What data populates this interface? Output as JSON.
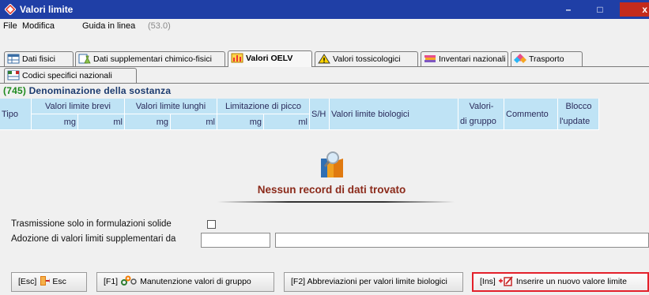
{
  "window": {
    "title": "Valori limite",
    "min_symbol": "–",
    "max_symbol": "□",
    "close_symbol": "x"
  },
  "menu": {
    "file": "File",
    "modifica": "Modifica",
    "guida": "Guida in linea",
    "version": "(53.0)"
  },
  "tabs": [
    {
      "label": "Dati fisici",
      "icon": "table-icon"
    },
    {
      "label": "Dati supplementari chimico-fisici",
      "icon": "chemistry-icon"
    },
    {
      "label": "Valori OELV",
      "icon": "chart-icon",
      "active": true
    },
    {
      "label": "Valori tossicologici",
      "icon": "warning-icon"
    },
    {
      "label": "Inventari nazionali",
      "icon": "books-icon"
    },
    {
      "label": "Trasporto",
      "icon": "transport-icon"
    },
    {
      "label": "Codici specifici nazionali",
      "icon": "flag-table-icon"
    }
  ],
  "section": {
    "number": "(745)",
    "title": "Denominazione della sostanza"
  },
  "grid": {
    "tipo": "Tipo",
    "brevi": "Valori limite brevi",
    "lunghi": "Valori limite lunghi",
    "picco": "Limitazione di picco",
    "mg": "mg",
    "ml": "ml",
    "sh": "S/H",
    "biologici": "Valori limite biologici",
    "gruppo_top": "Valori-",
    "gruppo_bottom": "di gruppo",
    "commento": "Commento",
    "blocco_top": "Blocco",
    "blocco_bottom": "l'update"
  },
  "empty_state": {
    "message": "Nessun record di dati trovato",
    "icon": "search-document-icon"
  },
  "form": {
    "trasmissione_label": "Trasmissione solo in formulazioni solide",
    "trasmissione_checked": false,
    "adozione_label": "Adozione di valori limiti supplementari da",
    "adozione_value_1": "",
    "adozione_value_2": ""
  },
  "buttons": {
    "esc": {
      "key": "[Esc]",
      "label": "Esc"
    },
    "f1": {
      "key": "[F1]",
      "label": "Manutenzione valori di gruppo"
    },
    "f2": {
      "key": "[F2]",
      "label": "Abbreviazioni per valori limite biologici"
    },
    "ins": {
      "key": "[Ins]",
      "label": "Inserire un nuovo valore limite"
    }
  },
  "colors": {
    "titlebar": "#1f3fa6",
    "grid_header": "#bfe3f5",
    "empty_text": "#8b2a1a",
    "highlight": "#e3202a",
    "section_number": "#1e8a1e"
  }
}
